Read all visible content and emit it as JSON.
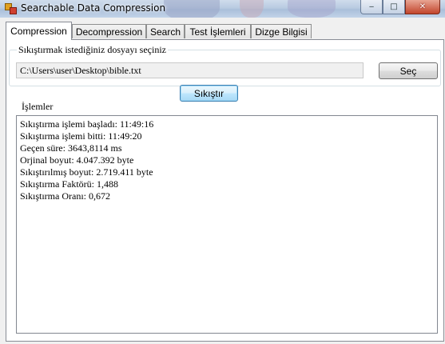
{
  "window": {
    "title": "Searchable Data Compression",
    "minimize_glyph": "‒",
    "maximize_glyph": "□",
    "close_glyph": "✕"
  },
  "tabs": [
    {
      "label": "Compression",
      "active": true
    },
    {
      "label": "Decompression",
      "active": false
    },
    {
      "label": "Search",
      "active": false
    },
    {
      "label": "Test İşlemleri",
      "active": false
    },
    {
      "label": "Dizge Bilgisi",
      "active": false
    }
  ],
  "compression": {
    "group_label": "Sıkıştırmak istediğiniz dosyayı seçiniz",
    "file_path": "C:\\Users\\user\\Desktop\\bible.txt",
    "select_button": "Seç",
    "compress_button": "Sıkıştır",
    "operations_label": "İşlemler",
    "log_lines": [
      "Sıkıştırma işlemi başladı: 11:49:16",
      "Sıkıştırma işlemi bitti: 11:49:20",
      "Geçen süre: 3643,8114 ms",
      "Orjinal boyut: 4.047.392 byte",
      "Sıkıştırılmış boyut: 2.719.411 byte",
      "Sıkıştırma Faktörü: 1,488",
      "Sıkıştırma Oranı: 0,672"
    ]
  }
}
